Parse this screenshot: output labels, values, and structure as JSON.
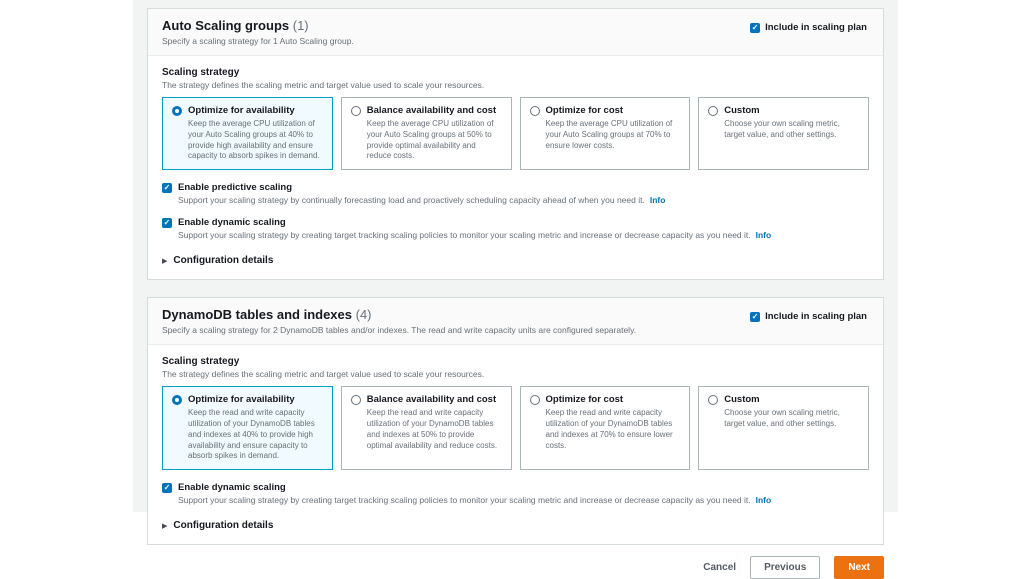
{
  "colors": {
    "content_background": "#f2f3f3",
    "accent_blue": "#0073bb",
    "selected_tile_border": "#00a1c9",
    "selected_tile_background": "#f1faff",
    "primary_button_orange": "#ec7211"
  },
  "sections": [
    {
      "title": "Auto Scaling groups",
      "count": "(1)",
      "description": "Specify a scaling strategy for 1 Auto Scaling group.",
      "include_label": "Include in scaling plan",
      "include_checked": true,
      "field_label": "Scaling strategy",
      "field_description": "The strategy defines the scaling metric and target value used to scale your resources.",
      "tiles": [
        {
          "label": "Optimize for availability",
          "selected": true,
          "description": "Keep the average CPU utilization of your Auto Scaling groups at 40% to provide high availability and ensure capacity to absorb spikes in demand."
        },
        {
          "label": "Balance availability and cost",
          "selected": false,
          "description": "Keep the average CPU utilization of your Auto Scaling groups at 50% to provide optimal availability and reduce costs."
        },
        {
          "label": "Optimize for cost",
          "selected": false,
          "description": "Keep the average CPU utilization of your Auto Scaling groups at 70% to ensure lower costs."
        },
        {
          "label": "Custom",
          "selected": false,
          "description": "Choose your own scaling metric, target value, and other settings."
        }
      ],
      "checkboxes": [
        {
          "label": "Enable predictive scaling",
          "checked": true,
          "description": "Support your scaling strategy by continually forecasting load and proactively scheduling capacity ahead of when you need it.",
          "info_label": "Info"
        },
        {
          "label": "Enable dynamic scaling",
          "checked": true,
          "description": "Support your scaling strategy by creating target tracking scaling policies to monitor your scaling metric and increase or decrease capacity as you need it.",
          "info_label": "Info"
        }
      ],
      "expander_label": "Configuration details"
    },
    {
      "title": "DynamoDB tables and indexes",
      "count": "(4)",
      "description": "Specify a scaling strategy for 2 DynamoDB tables and/or indexes. The read and write capacity units are configured separately.",
      "include_label": "Include in scaling plan",
      "include_checked": true,
      "field_label": "Scaling strategy",
      "field_description": "The strategy defines the scaling metric and target value used to scale your resources.",
      "tiles": [
        {
          "label": "Optimize for availability",
          "selected": true,
          "description": "Keep the read and write capacity utilization of your DynamoDB tables and indexes at 40% to provide high availability and ensure capacity to absorb spikes in demand."
        },
        {
          "label": "Balance availability and cost",
          "selected": false,
          "description": "Keep the read and write capacity utilization of your DynamoDB tables and indexes at 50% to provide optimal availability and reduce costs."
        },
        {
          "label": "Optimize for cost",
          "selected": false,
          "description": "Keep the read and write capacity utilization of your DynamoDB tables and indexes at 70% to ensure lower costs."
        },
        {
          "label": "Custom",
          "selected": false,
          "description": "Choose your own scaling metric, target value, and other settings."
        }
      ],
      "checkboxes": [
        {
          "label": "Enable dynamic scaling",
          "checked": true,
          "description": "Support your scaling strategy by creating target tracking scaling policies to monitor your scaling metric and increase or decrease capacity as you need it.",
          "info_label": "Info"
        }
      ],
      "expander_label": "Configuration details"
    }
  ],
  "footer": {
    "cancel_label": "Cancel",
    "previous_label": "Previous",
    "next_label": "Next"
  }
}
